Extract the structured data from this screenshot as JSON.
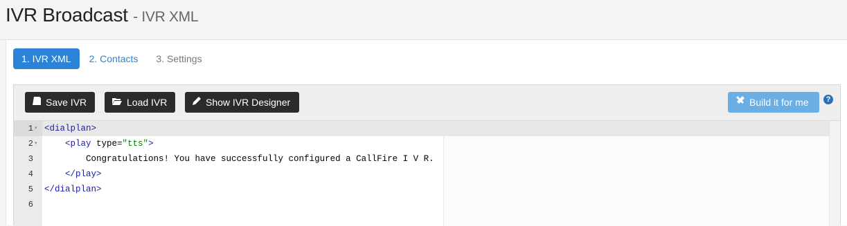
{
  "header": {
    "title": "IVR Broadcast",
    "subtitle": "- IVR XML"
  },
  "tabs": [
    {
      "label": "1. IVR XML",
      "state": "active"
    },
    {
      "label": "2. Contacts",
      "state": "link"
    },
    {
      "label": "3. Settings",
      "state": "muted"
    }
  ],
  "toolbar": {
    "save_label": "Save IVR",
    "load_label": "Load IVR",
    "designer_label": "Show IVR Designer",
    "build_label": "Build it for me",
    "help_label": "?"
  },
  "editor": {
    "lines": [
      {
        "num": "1",
        "fold": "▾",
        "parts": [
          [
            "tag",
            "<dialplan>"
          ]
        ]
      },
      {
        "num": "2",
        "fold": "▾",
        "parts": [
          [
            "plain",
            "    "
          ],
          [
            "tag",
            "<play"
          ],
          [
            "attr",
            " type="
          ],
          [
            "str",
            "\"tts\""
          ],
          [
            "tag",
            ">"
          ]
        ]
      },
      {
        "num": "3",
        "fold": "",
        "parts": [
          [
            "plain",
            "        Congratulations! You have successfully configured a CallFire I V R."
          ]
        ]
      },
      {
        "num": "4",
        "fold": "",
        "parts": [
          [
            "plain",
            "    "
          ],
          [
            "tag",
            "</play>"
          ]
        ]
      },
      {
        "num": "5",
        "fold": "",
        "parts": [
          [
            "tag",
            "</dialplan>"
          ]
        ]
      },
      {
        "num": "6",
        "fold": "",
        "parts": []
      }
    ]
  },
  "colors": {
    "accent": "#2a83d6",
    "button_dark": "#2b2b2b",
    "button_build": "#6aaee4",
    "xml_tag": "#1a1aa6",
    "xml_string": "#008000"
  },
  "icons": {
    "save": "save-icon",
    "load": "folder-open-icon",
    "designer": "pencil-icon",
    "build": "wrench-icon",
    "help": "question-circle-icon"
  }
}
